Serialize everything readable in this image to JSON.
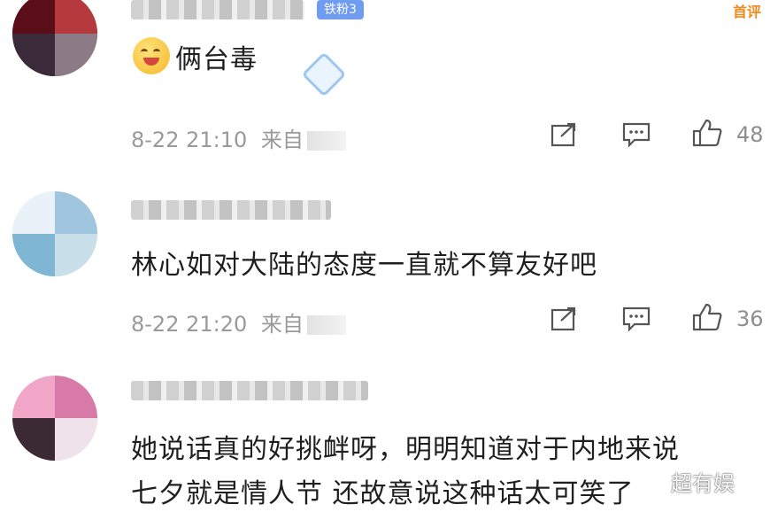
{
  "comments": [
    {
      "text": "俩台毒",
      "badge": "铁粉3",
      "time": "8-22 21:10",
      "source_prefix": "来自",
      "like_count": "48"
    },
    {
      "text": "林心如对大陆的态度一直就不算友好吧",
      "time": "8-22 21:20",
      "source_prefix": "来自",
      "like_count": "36"
    },
    {
      "text_line1": "她说话真的好挑衅呀，明明知道对于内地来说",
      "text_line2": "七夕就是情人节 还故意说这种话太可笑了"
    }
  ],
  "top_right_label": "首评",
  "watermark": "超有娱",
  "icons": [
    "share-icon",
    "comment-icon",
    "like-icon"
  ]
}
